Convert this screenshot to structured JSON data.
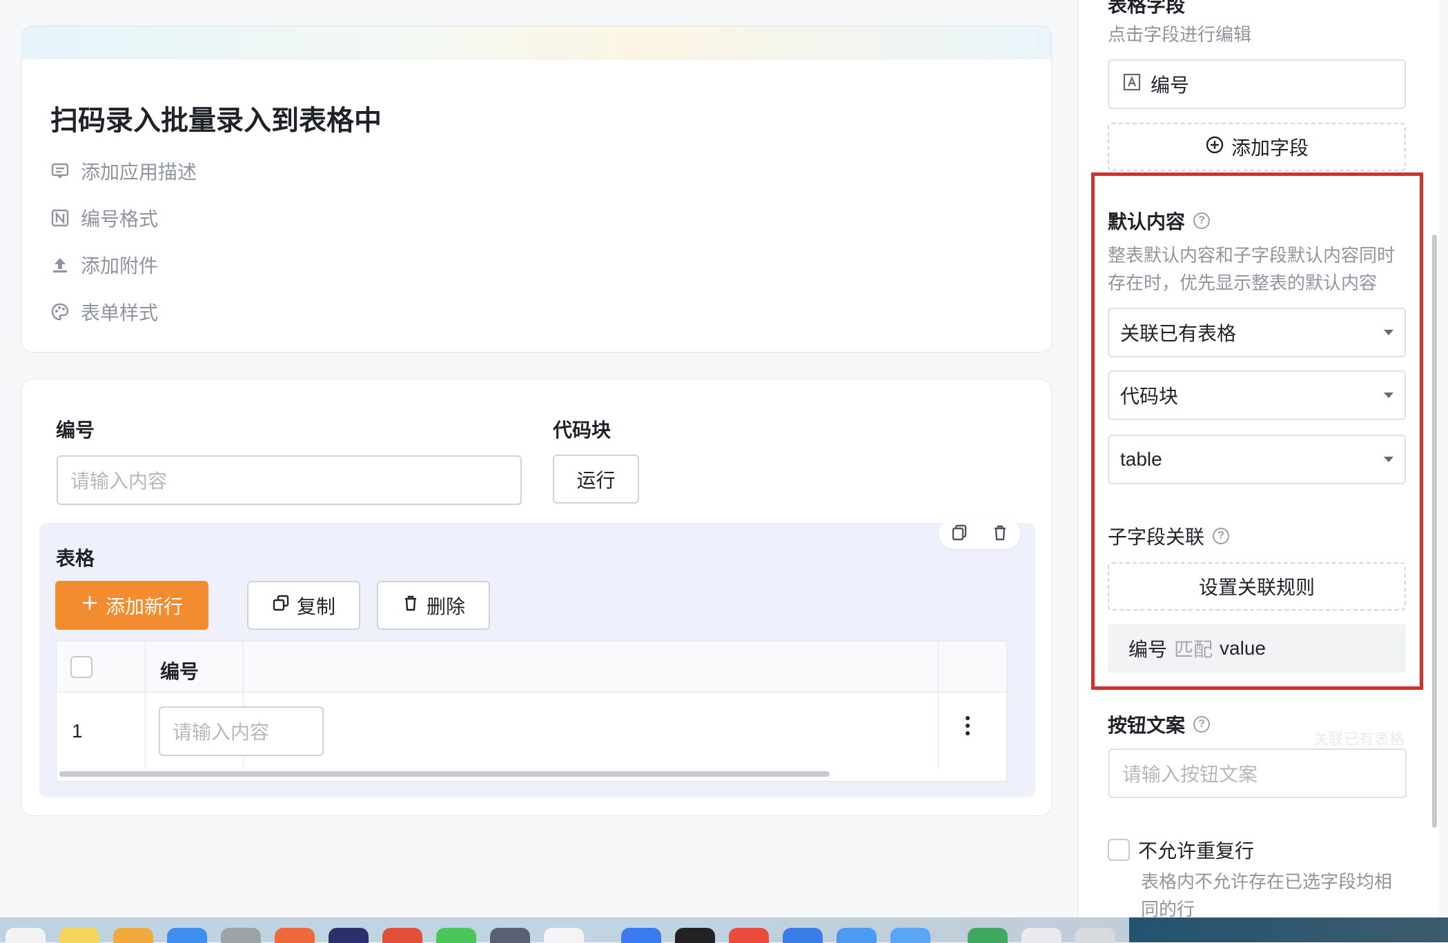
{
  "form": {
    "title": "扫码录入批量录入到表格中",
    "options": [
      {
        "label": "添加应用描述",
        "icon": "comment-icon"
      },
      {
        "label": "编号格式",
        "icon": "number-format-icon"
      },
      {
        "label": "添加附件",
        "icon": "upload-icon"
      },
      {
        "label": "表单样式",
        "icon": "palette-icon"
      }
    ]
  },
  "fields": {
    "number_label": "编号",
    "number_placeholder": "请输入内容",
    "code_label": "代码块",
    "run_button": "运行"
  },
  "table_block": {
    "title": "表格",
    "add_row": "添加新行",
    "copy": "复制",
    "delete": "删除",
    "column_header": "编号",
    "rows": [
      {
        "index": "1",
        "placeholder": "请输入内容"
      }
    ]
  },
  "panel": {
    "table_fields_title": "表格字段",
    "table_fields_hint": "点击字段进行编辑",
    "field_item": "编号",
    "add_field": "添加字段",
    "default_content_title": "默认内容",
    "default_content_hint_line1": "整表默认内容和子字段默认内容同时",
    "default_content_hint_line2": "存在时，优先显示整表的默认内容",
    "select_mode": "关联已有表格",
    "select_source": "代码块",
    "select_table": "table",
    "sub_field_link_title": "子字段关联",
    "set_link_rule": "设置关联规则",
    "rule": {
      "left": "编号",
      "op": "匹配",
      "right": "value"
    },
    "button_text_title": "按钮文案",
    "button_text_placeholder": "请输入按钮文案",
    "ghost_tooltip": "关联已有表格",
    "no_duplicate_label": "不允许重复行",
    "no_duplicate_hint_line1": "表格内不允许存在已选字段均相",
    "no_duplicate_hint_line2": "同的行"
  },
  "colors": {
    "accent": "#f28c2f",
    "highlight_frame": "#d0322c",
    "table_block_bg": "#eef1fb"
  }
}
